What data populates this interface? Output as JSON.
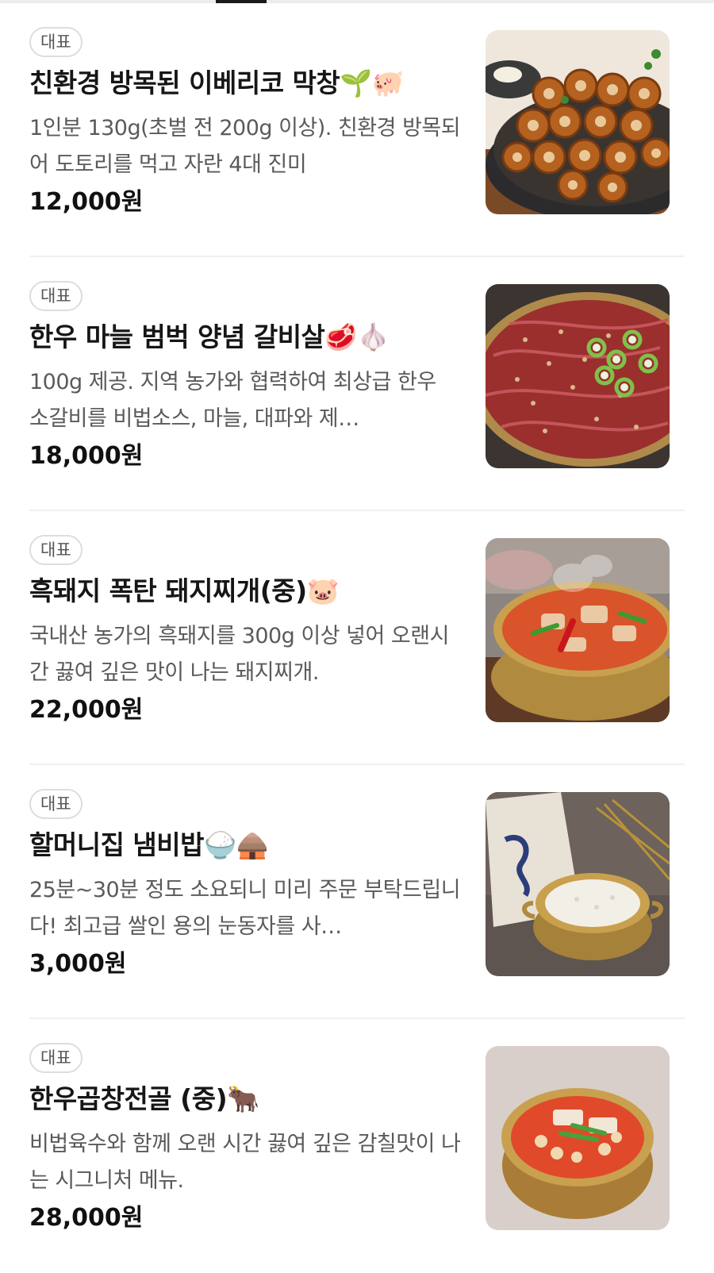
{
  "menu": {
    "items": [
      {
        "badge": "대표",
        "name": "친환경 방목된 이베리코 막창🌱🐖",
        "description": "1인분 130g(초벌 전 200g 이상). 친환경 방목되어 도토리를 먹고 자란 4대 진미",
        "price": "12,000원",
        "image_icon": "grilled-makchang-photo"
      },
      {
        "badge": "대표",
        "name": "한우 마늘 범벅 양념 갈비살🥩🧄",
        "description": "100g 제공. 지역 농가와 협력하여 최상급 한우 소갈비를 비법소스, 마늘, 대파와 제…",
        "price": "18,000원",
        "image_icon": "marinated-galbi-photo"
      },
      {
        "badge": "대표",
        "name": "흑돼지 폭탄 돼지찌개(중)🐷",
        "description": "국내산 농가의 흑돼지를 300g 이상 넣어 오랜시간 끓여 깊은 맛이 나는 돼지찌개.",
        "price": "22,000원",
        "image_icon": "pork-stew-photo"
      },
      {
        "badge": "대표",
        "name": "할머니집 냄비밥🍚🛖",
        "description": "25분~30분 정도 소요되니 미리 주문 부탁드립니다! 최고급 쌀인 용의 눈동자를 사…",
        "price": "3,000원",
        "image_icon": "pot-rice-photo"
      },
      {
        "badge": "대표",
        "name": "한우곱창전골 (중)🐂",
        "description": "비법육수와 함께 오랜 시간 끓여 깊은 감칠맛이 나는 시그니처 메뉴.",
        "price": "28,000원",
        "image_icon": "gopchang-hotpot-photo"
      }
    ]
  }
}
